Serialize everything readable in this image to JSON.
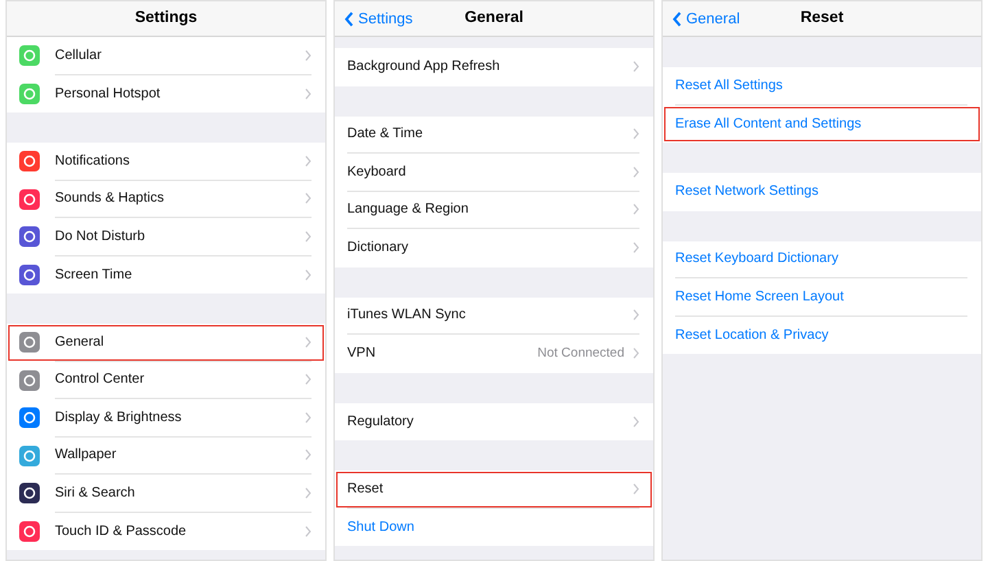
{
  "panels": [
    {
      "title": "Settings",
      "sections": [
        [
          {
            "label": "Cellular",
            "color": "#4cd964",
            "highlighted": false
          },
          {
            "label": "Personal Hotspot",
            "color": "#4cd964",
            "highlighted": false
          }
        ],
        [
          {
            "label": "Notifications",
            "color": "#ff3b30",
            "highlighted": false
          },
          {
            "label": "Sounds & Haptics",
            "color": "#ff2d55",
            "highlighted": false
          },
          {
            "label": "Do Not Disturb",
            "color": "#5856d6",
            "highlighted": false
          },
          {
            "label": "Screen Time",
            "color": "#5856d6",
            "highlighted": false
          }
        ],
        [
          {
            "label": "General",
            "color": "#8e8e93",
            "highlighted": true
          },
          {
            "label": "Control Center",
            "color": "#8e8e93",
            "highlighted": false
          },
          {
            "label": "Display & Brightness",
            "color": "#007aff",
            "highlighted": false
          },
          {
            "label": "Wallpaper",
            "color": "#34aadc",
            "highlighted": false
          },
          {
            "label": "Siri & Search",
            "color": "#2c2c54",
            "highlighted": false
          },
          {
            "label": "Touch ID & Passcode",
            "color": "#ff2d55",
            "highlighted": false
          }
        ]
      ]
    },
    {
      "title": "General",
      "back": "Settings",
      "sections": [
        [
          {
            "label": "Background App Refresh",
            "kind": "nav",
            "highlighted": false
          }
        ],
        [
          {
            "label": "Date & Time",
            "kind": "nav",
            "highlighted": false
          },
          {
            "label": "Keyboard",
            "kind": "nav",
            "highlighted": false
          },
          {
            "label": "Language & Region",
            "kind": "nav",
            "highlighted": false
          },
          {
            "label": "Dictionary",
            "kind": "nav",
            "highlighted": false
          }
        ],
        [
          {
            "label": "iTunes WLAN Sync",
            "kind": "nav",
            "highlighted": false
          },
          {
            "label": "VPN",
            "kind": "nav",
            "value": "Not Connected",
            "highlighted": false
          }
        ],
        [
          {
            "label": "Regulatory",
            "kind": "nav",
            "highlighted": false
          }
        ],
        [
          {
            "label": "Reset",
            "kind": "nav",
            "highlighted": true
          },
          {
            "label": "Shut Down",
            "kind": "action",
            "highlighted": false
          }
        ]
      ]
    },
    {
      "title": "Reset",
      "back": "General",
      "sections": [
        [
          {
            "label": "Reset All Settings",
            "kind": "action",
            "highlighted": false
          },
          {
            "label": "Erase All Content and Settings",
            "kind": "action",
            "highlighted": true
          }
        ],
        [
          {
            "label": "Reset Network Settings",
            "kind": "action",
            "highlighted": false
          }
        ],
        [
          {
            "label": "Reset Keyboard Dictionary",
            "kind": "action",
            "highlighted": false
          },
          {
            "label": "Reset Home Screen Layout",
            "kind": "action",
            "highlighted": false
          },
          {
            "label": "Reset Location & Privacy",
            "kind": "action",
            "highlighted": false
          }
        ]
      ]
    }
  ]
}
